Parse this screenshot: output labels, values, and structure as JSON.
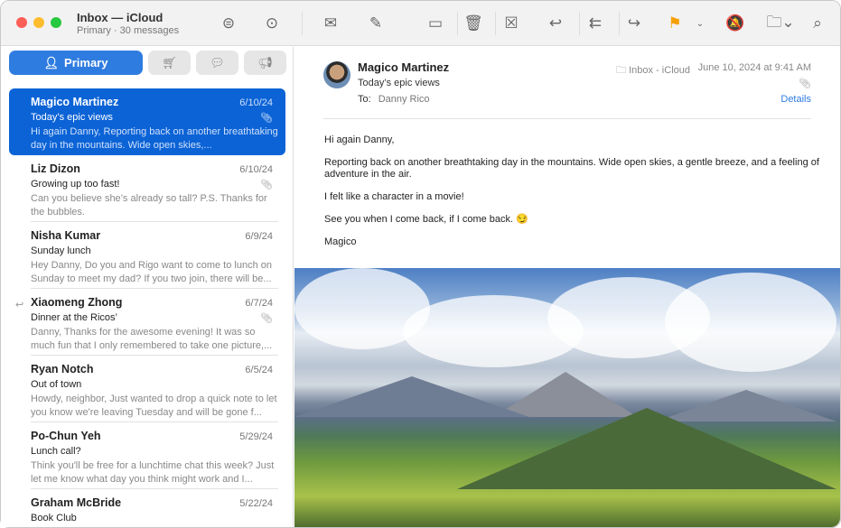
{
  "window": {
    "title": "Inbox — iCloud",
    "subtitle": "Primary · 30 messages"
  },
  "toolbar": {
    "icons": [
      "filter-icon",
      "more-icon",
      "envelope-icon",
      "compose-icon",
      "archive-icon",
      "trash-icon",
      "junk-icon",
      "reply-icon",
      "reply-all-icon",
      "forward-icon",
      "flag-icon",
      "chevron-down-icon",
      "mute-bell-icon",
      "folder-icon",
      "search-icon"
    ],
    "flag_color": "#f5a000"
  },
  "tabs": {
    "primary": "Primary",
    "others": [
      "shopping-cart-icon",
      "chat-icon",
      "megaphone-icon"
    ]
  },
  "messages": [
    {
      "sender": "Magico Martinez",
      "date": "6/10/24",
      "subject": "Today’s epic views",
      "preview": "Hi again Danny, Reporting back on another breathtaking day in the mountains. Wide open skies,...",
      "attachment": true,
      "selected": true
    },
    {
      "sender": "Liz Dizon",
      "date": "6/10/24",
      "subject": "Growing up too fast!",
      "preview": "Can you believe she’s already so tall? P.S. Thanks for the bubbles.",
      "attachment": true
    },
    {
      "sender": "Nisha Kumar",
      "date": "6/9/24",
      "subject": "Sunday lunch",
      "preview": "Hey Danny, Do you and Rigo want to come to lunch on Sunday to meet my dad? If you two join, there will be..."
    },
    {
      "sender": "Xiaomeng Zhong",
      "date": "6/7/24",
      "subject": "Dinner at the Ricos’",
      "preview": "Danny, Thanks for the awesome evening! It was so much fun that I only remembered to take one picture,...",
      "attachment": true,
      "replied": true
    },
    {
      "sender": "Ryan Notch",
      "date": "6/5/24",
      "subject": "Out of town",
      "preview": "Howdy, neighbor, Just wanted to drop a quick note to let you know we're leaving Tuesday and will be gone f..."
    },
    {
      "sender": "Po-Chun Yeh",
      "date": "5/29/24",
      "subject": "Lunch call?",
      "preview": "Think you'll be free for a lunchtime chat this week? Just let me know what day you think might work and I..."
    },
    {
      "sender": "Graham McBride",
      "date": "5/22/24",
      "subject": "Book Club",
      "preview": ""
    }
  ],
  "email": {
    "from": "Magico Martinez",
    "subject": "Today’s epic views",
    "to_label": "To:",
    "to": "Danny Rico",
    "mailbox": "Inbox - iCloud",
    "date": "June 10, 2024 at 9:41 AM",
    "details": "Details",
    "body": [
      "Hi again Danny,",
      "Reporting back on another breathtaking day in the mountains. Wide open skies, a gentle breeze, and a feeling of adventure in the air.",
      "I felt like a character in a movie!",
      "See you when I come back, if I come back. 😏",
      "Magico"
    ]
  }
}
